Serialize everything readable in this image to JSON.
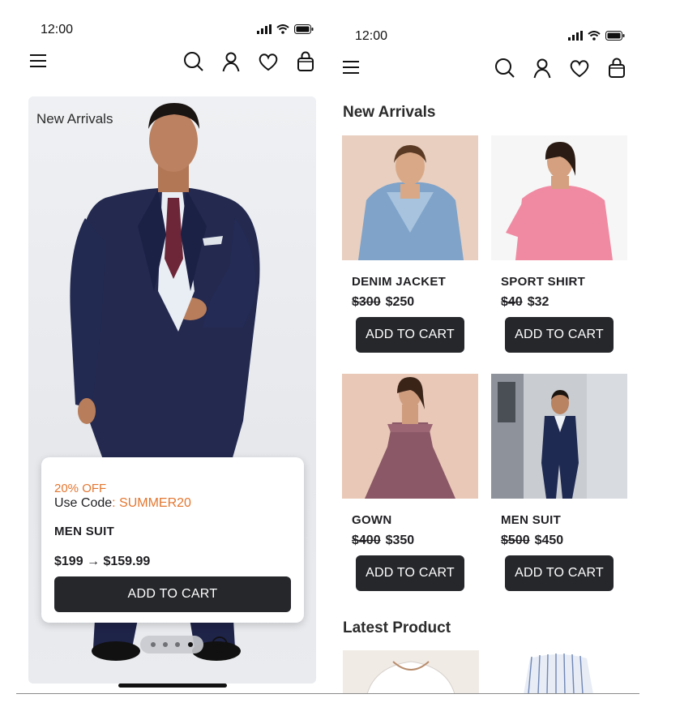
{
  "left_screen": {
    "status_time": "12:00",
    "hero_title": "New Arrivals",
    "promo": {
      "discount": "20% OFF",
      "code_label": "Use Code",
      "code_sep": ": ",
      "code_value": "SUMMER20",
      "product_name": "MEN SUIT",
      "price": "$199 → $159.99",
      "cta": "ADD TO CART"
    },
    "carousel": {
      "dots": 4,
      "active_index": 3
    }
  },
  "right_screen": {
    "status_time": "12:00",
    "section_new": "New Arrivals",
    "products": [
      {
        "name": "DENIM JACKET",
        "old_price": "$300",
        "price": "$250",
        "cta": "ADD TO CART"
      },
      {
        "name": "SPORT SHIRT",
        "old_price": "$40",
        "price": "$32",
        "cta": "ADD TO CART"
      },
      {
        "name": "GOWN",
        "old_price": "$400",
        "price": "$350",
        "cta": "ADD TO CART"
      },
      {
        "name": "MEN SUIT",
        "old_price": "$500",
        "price": "$450",
        "cta": "ADD TO CART"
      }
    ],
    "section_latest": "Latest Product"
  },
  "icons": [
    "signal-icon",
    "wifi-icon",
    "battery-icon",
    "menu-icon",
    "search-icon",
    "user-icon",
    "heart-icon",
    "bag-icon",
    "arrow-right-circle-icon"
  ],
  "colors": {
    "accent": "#e4762f",
    "button": "#26272b",
    "text": "#1f1f23"
  }
}
